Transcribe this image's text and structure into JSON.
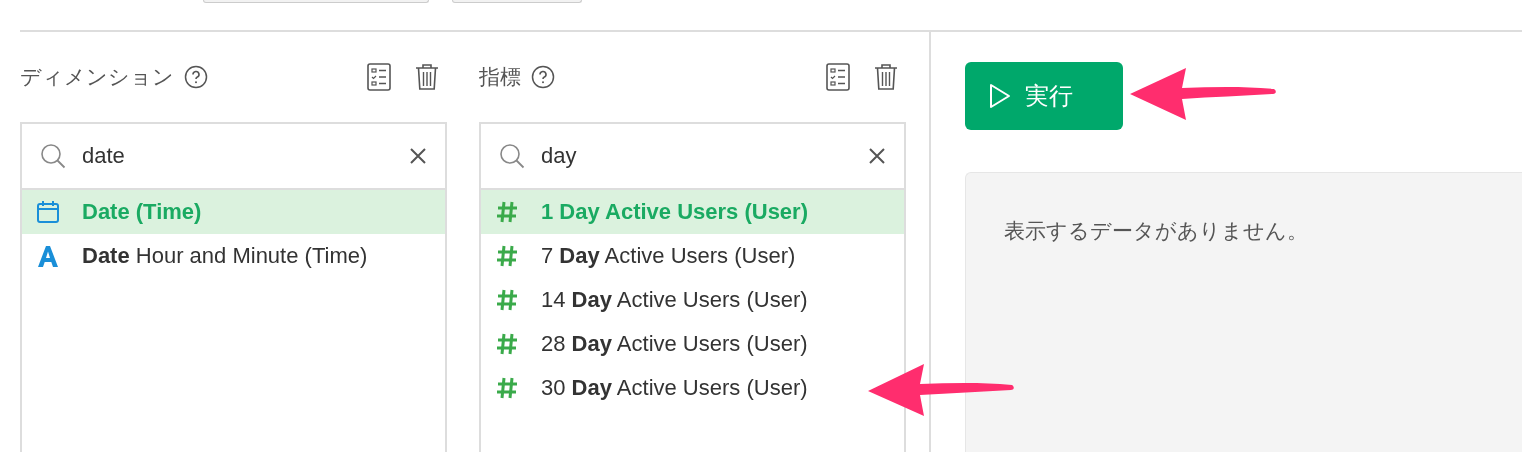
{
  "panels": [
    {
      "title": "ディメンション",
      "search": {
        "value": "date"
      },
      "items": [
        {
          "kind": "date",
          "label": "Date (Time)",
          "selected": true
        },
        {
          "kind": "text",
          "label": "**Date** Hour and Minute (Time)",
          "selected": false
        }
      ]
    },
    {
      "title": "指標",
      "search": {
        "value": "day"
      },
      "items": [
        {
          "kind": "number",
          "label": "1 Day Active Users (User)",
          "selected": true
        },
        {
          "kind": "number",
          "label": "7 **Day** Active Users (User)",
          "selected": false
        },
        {
          "kind": "number",
          "label": "14 **Day** Active Users (User)",
          "selected": false
        },
        {
          "kind": "number",
          "label": "28 **Day** Active Users (User)",
          "selected": false
        },
        {
          "kind": "number",
          "label": "30 **Day** Active Users (User)",
          "selected": false
        }
      ]
    }
  ],
  "run_button": {
    "label": "実行"
  },
  "result": {
    "message": "表示するデータがありません。"
  }
}
